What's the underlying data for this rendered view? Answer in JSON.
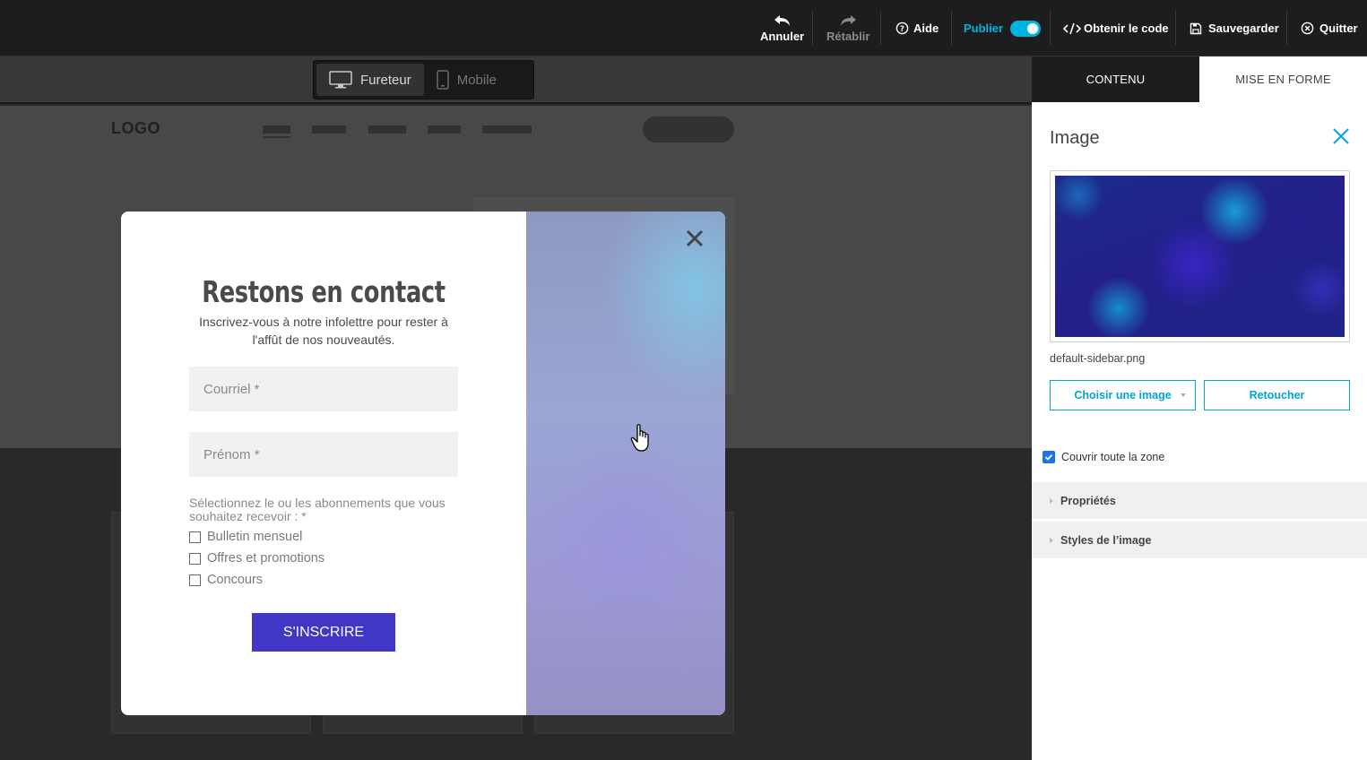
{
  "topbar": {
    "undo": "Annuler",
    "redo": "Rétablir",
    "help": "Aide",
    "publish": "Publier",
    "get_code": "Obtenir le code",
    "save": "Sauvegarder",
    "quit": "Quitter",
    "accent": "#00b4e0"
  },
  "viewmode": {
    "desktop": "Fureteur",
    "mobile": "Mobile"
  },
  "site": {
    "logo": "LOGO"
  },
  "popup": {
    "title": "Restons en contact",
    "subtitle": "Inscrivez-vous à notre infolettre pour rester à l'affût de nos nouveautés.",
    "email_placeholder": "Courriel *",
    "firstname_placeholder": "Prénom *",
    "select_label": "Sélectionnez le ou les abonnements que vous souhaitez recevoir : *",
    "options": [
      "Bulletin mensuel",
      "Offres et promotions",
      "Concours"
    ],
    "submit": "S'INSCRIRE",
    "button_color": "#4236c4"
  },
  "panel": {
    "tabs": [
      "CONTENU",
      "MISE EN FORME"
    ],
    "heading": "Image",
    "filename": "default-sidebar.png",
    "choose_image": "Choisir une image",
    "retouch": "Retoucher",
    "cover_label": "Couvrir toute la zone",
    "cover_checked": true,
    "sections": [
      "Propriétés",
      "Styles de l’image"
    ]
  }
}
